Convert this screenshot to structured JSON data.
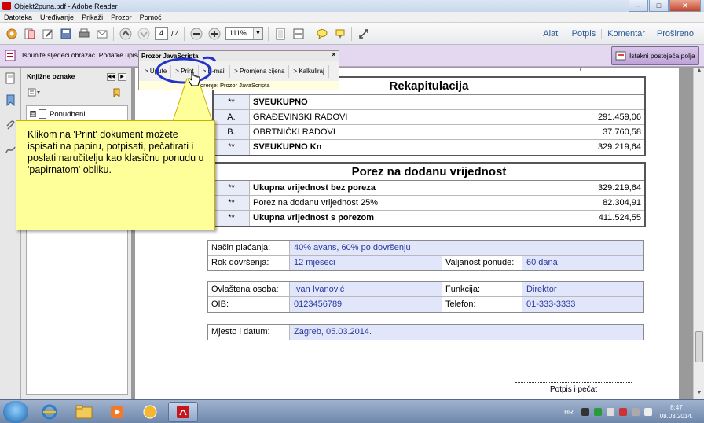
{
  "window": {
    "title": "Objekt2puna.pdf - Adobe Reader"
  },
  "menu": [
    "Datoteka",
    "Uređivanje",
    "Prikaži",
    "Prozor",
    "Pomoć"
  ],
  "toolbar": {
    "page_current": "4",
    "page_total": "/ 4",
    "zoom": "111%",
    "links": [
      "Alati",
      "Potpis",
      "Komentar",
      "Prošireno"
    ]
  },
  "forms_bar": {
    "message": "Ispunite sljedeći obrazac. Podatke upisa",
    "highlight_button": "Istakni postojeća polja"
  },
  "js_panel": {
    "title": "Prozor JavaScripta",
    "close": "×",
    "buttons": [
      "> Upute",
      "> Print",
      "> E-mail",
      "> Promjena cijena",
      "> Kalkuliraj"
    ],
    "status": "orenje: Prozor JavaScripta"
  },
  "bookmarks": {
    "title": "Knjižne oznake",
    "item": "Ponudbeni",
    "expander": "⊟"
  },
  "document": {
    "recap_title": "Rekapitulacija",
    "recap_rows": [
      {
        "c1": "**",
        "c2": "SVEUKUPNO",
        "c3": "",
        "bold": true
      },
      {
        "c1": "A.",
        "c2": "GRAĐEVINSKI RADOVI",
        "c3": "291.459,06",
        "bold": false
      },
      {
        "c1": "B.",
        "c2": "OBRTNIČKI RADOVI",
        "c3": "37.760,58",
        "bold": false
      },
      {
        "c1": "**",
        "c2": "SVEUKUPNO Kn",
        "c3": "329.219,64",
        "bold": true
      }
    ],
    "tax_title": "Porez na dodanu vrijednost",
    "tax_rows": [
      {
        "c1": "**",
        "c2": "Ukupna vrijednost bez poreza",
        "c3": "329.219,64",
        "bold": true
      },
      {
        "c1": "**",
        "c2": "Porez na dodanu vrijednost 25%",
        "c3": "82.304,91",
        "bold": false
      },
      {
        "c1": "**",
        "c2": "Ukupna vrijednost s porezom",
        "c3": "411.524,55",
        "bold": true
      }
    ],
    "payment": {
      "method_label": "Način plaćanja:",
      "method_value": "40% avans, 60% po dovršenju",
      "deadline_label": "Rok dovršenja:",
      "deadline_value": "12 mjeseci",
      "validity_label": "Valjanost ponude:",
      "validity_value": "60 dana"
    },
    "person": {
      "name_label": "Ovlaštena osoba:",
      "name_value": "Ivan Ivanović",
      "role_label": "Funkcija:",
      "role_value": "Direktor",
      "oib_label": "OIB:",
      "oib_value": "0123456789",
      "phone_label": "Telefon:",
      "phone_value": "01-333-3333"
    },
    "place": {
      "label": "Mjesto i datum:",
      "value": "Zagreb, 05.03.2014."
    },
    "signature_label": "Potpis i pečat"
  },
  "callout": {
    "text": "Klikom na 'Print' dokument možete ispisati na papiru, potpisati, pečatirati i poslati naručitelju kao klasičnu ponudu u 'papirnatom' obliku."
  },
  "taskbar": {
    "language": "HR",
    "time": "8:47",
    "date": "08.03.2014."
  },
  "colors": {
    "callout_bg": "#ffff99",
    "form_field_bg": "#e2e6fa",
    "forms_bar_bg": "#e4d7f0",
    "highlight_circle": "#2233cc"
  }
}
